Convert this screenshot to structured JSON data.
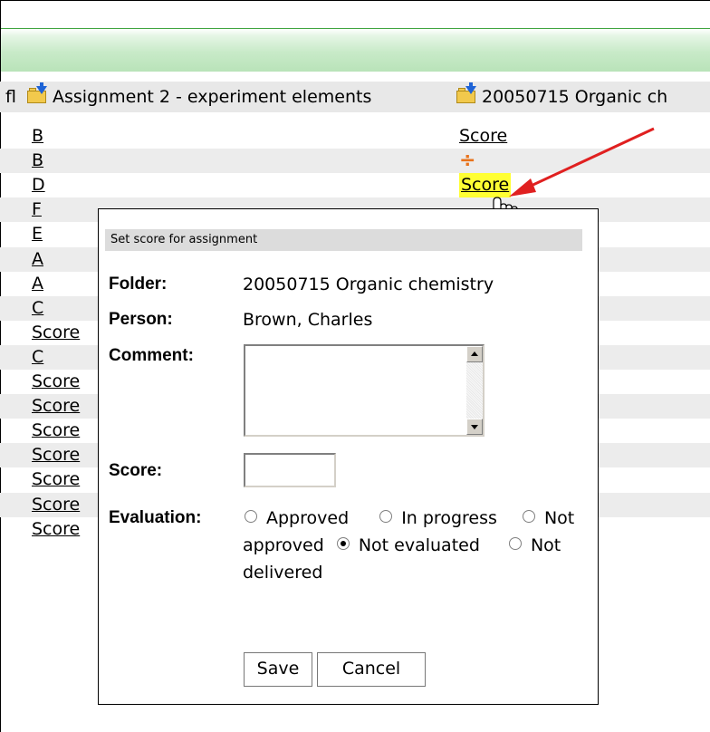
{
  "header": {
    "truncated_label": "fl",
    "assignment_label": "Assignment 2 - experiment elements",
    "organic_label": "20050715 Organic ch"
  },
  "rows": [
    {
      "grade": "B",
      "score": "Score",
      "score_kind": "link"
    },
    {
      "grade": "B",
      "score": "÷",
      "score_kind": "divide-icon"
    },
    {
      "grade": "D",
      "score": "Score",
      "score_kind": "highlight"
    },
    {
      "grade": "F",
      "score": "",
      "score_kind": "none"
    },
    {
      "grade": "E",
      "score": "",
      "score_kind": "none"
    },
    {
      "grade": "A",
      "score": "",
      "score_kind": "none"
    },
    {
      "grade": "A",
      "score": "",
      "score_kind": "none"
    },
    {
      "grade": "C",
      "score": "",
      "score_kind": "none"
    },
    {
      "grade": "Score",
      "score": "",
      "score_kind": "none"
    },
    {
      "grade": "C",
      "score": "",
      "score_kind": "none"
    },
    {
      "grade": "Score",
      "score": "",
      "score_kind": "none"
    },
    {
      "grade": "Score",
      "score": "",
      "score_kind": "none"
    },
    {
      "grade": "Score",
      "score": "",
      "score_kind": "none"
    },
    {
      "grade": "Score",
      "score": "",
      "score_kind": "none"
    },
    {
      "grade": "Score",
      "score": "",
      "score_kind": "none"
    },
    {
      "grade": "Score",
      "score": "",
      "score_kind": "none"
    },
    {
      "grade": "Score",
      "score": "÷",
      "score_kind": "divide-icon"
    }
  ],
  "dialog": {
    "title": "Set score for assignment",
    "folder_label": "Folder:",
    "folder_value": "20050715 Organic chemistry",
    "person_label": "Person:",
    "person_value": "Brown, Charles",
    "comment_label": "Comment:",
    "comment_value": "",
    "score_label": "Score:",
    "score_value": "",
    "evaluation_label": "Evaluation:",
    "options": [
      "Approved",
      "In progress",
      "Not approved",
      "Not evaluated",
      "Not delivered"
    ],
    "selected_option": "Not evaluated",
    "save_label": "Save",
    "cancel_label": "Cancel"
  },
  "colors": {
    "header_band": "#c8eac8",
    "row_shade": "#ececec",
    "highlight": "#ffff33",
    "arrow": "#e02020",
    "divide_icon": "#e8731c"
  }
}
